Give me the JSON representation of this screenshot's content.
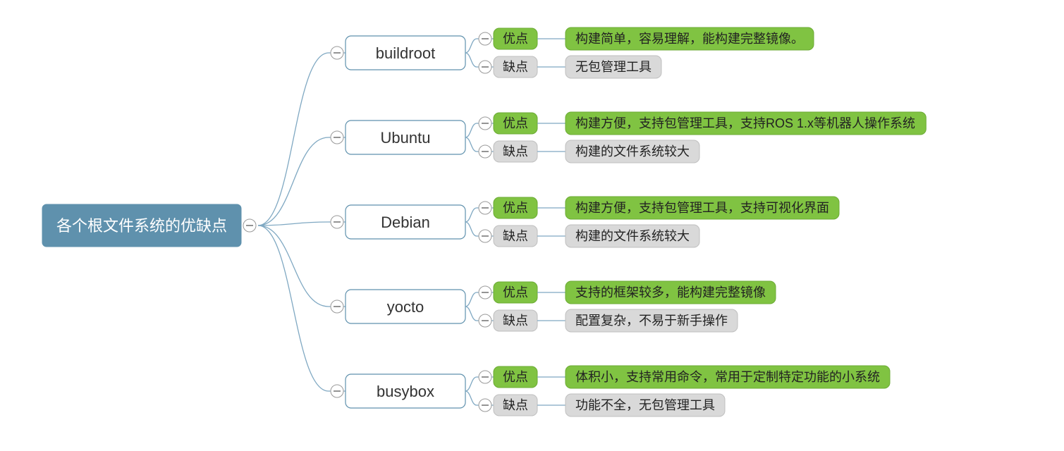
{
  "root": {
    "title": "各个根文件系统的优缺点"
  },
  "labels": {
    "advantage": "优点",
    "disadvantage": "缺点"
  },
  "systems": [
    {
      "name": "buildroot",
      "advantage": "构建简单，容易理解，能构建完整镜像。",
      "disadvantage": "无包管理工具"
    },
    {
      "name": "Ubuntu",
      "advantage": "构建方便，支持包管理工具，支持ROS 1.x等机器人操作系统",
      "disadvantage": "构建的文件系统较大"
    },
    {
      "name": "Debian",
      "advantage": "构建方便，支持包管理工具，支持可视化界面",
      "disadvantage": "构建的文件系统较大"
    },
    {
      "name": "yocto",
      "advantage": "支持的框架较多，能构建完整镜像",
      "disadvantage": "配置复杂，不易于新手操作"
    },
    {
      "name": "busybox",
      "advantage": "体积小，支持常用命令，常用于定制特定功能的小系统",
      "disadvantage": "功能不全，无包管理工具"
    }
  ]
}
